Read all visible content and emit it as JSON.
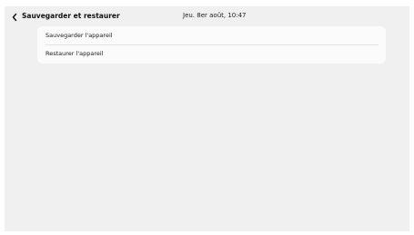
{
  "header": {
    "title": "Sauvegarder et restaurer",
    "datetime": "Jeu. 8er août, 10:47",
    "back_icon": "chevron-left-icon"
  },
  "menu": {
    "items": [
      {
        "label": "Sauvegarder l'appareil"
      },
      {
        "label": "Restaurer l'appareil"
      }
    ]
  },
  "colors": {
    "background": "#f0f0f0",
    "card": "#fbfbfb",
    "text": "#111111"
  }
}
